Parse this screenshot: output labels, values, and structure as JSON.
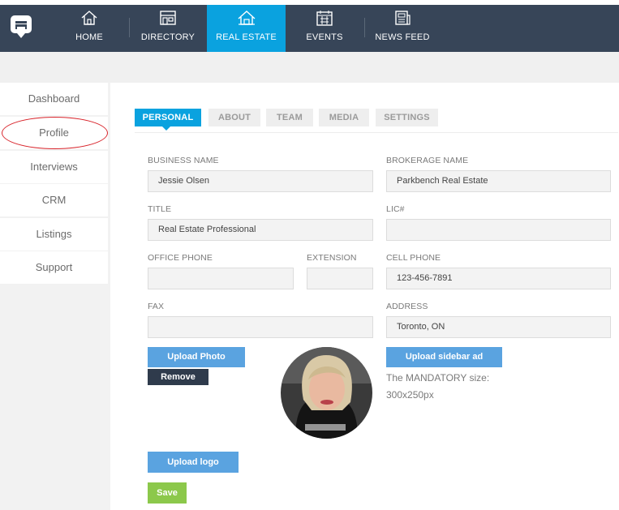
{
  "nav": {
    "items": [
      {
        "label": "HOME",
        "icon": "home-icon"
      },
      {
        "label": "DIRECTORY",
        "icon": "storefront-icon"
      },
      {
        "label": "REAL ESTATE",
        "icon": "house-icon"
      },
      {
        "label": "EVENTS",
        "icon": "calendar-icon"
      },
      {
        "label": "NEWS FEED",
        "icon": "newspaper-icon"
      }
    ],
    "active_color": "#0aa2df",
    "bar_color": "#374558"
  },
  "sidebar": {
    "items": [
      {
        "label": "Dashboard"
      },
      {
        "label": "Profile"
      },
      {
        "label": "Interviews"
      },
      {
        "label": "CRM"
      },
      {
        "label": "Listings"
      },
      {
        "label": "Support"
      }
    ]
  },
  "tabs": [
    {
      "label": "PERSONAL"
    },
    {
      "label": "ABOUT"
    },
    {
      "label": "TEAM"
    },
    {
      "label": "MEDIA"
    },
    {
      "label": "SETTINGS"
    }
  ],
  "form": {
    "business_name": {
      "label": "BUSINESS NAME",
      "value": "Jessie Olsen"
    },
    "brokerage_name": {
      "label": "BROKERAGE NAME",
      "value": "Parkbench Real Estate"
    },
    "title": {
      "label": "TITLE",
      "value": "Real Estate Professional"
    },
    "lic": {
      "label": "LIC#",
      "value": ""
    },
    "office_phone": {
      "label": "OFFICE PHONE",
      "value": ""
    },
    "extension": {
      "label": "EXTENSION",
      "value": ""
    },
    "cell_phone": {
      "label": "CELL PHONE",
      "value": "123-456-7891"
    },
    "fax": {
      "label": "FAX",
      "value": ""
    },
    "address": {
      "label": "ADDRESS",
      "value": "Toronto, ON"
    }
  },
  "buttons": {
    "upload_photo": "Upload Photo",
    "remove": "Remove",
    "upload_sidebar_ad": "Upload sidebar ad",
    "upload_logo": "Upload logo",
    "save": "Save"
  },
  "sidebar_ad_note": "The MANDATORY size: 300x250px"
}
